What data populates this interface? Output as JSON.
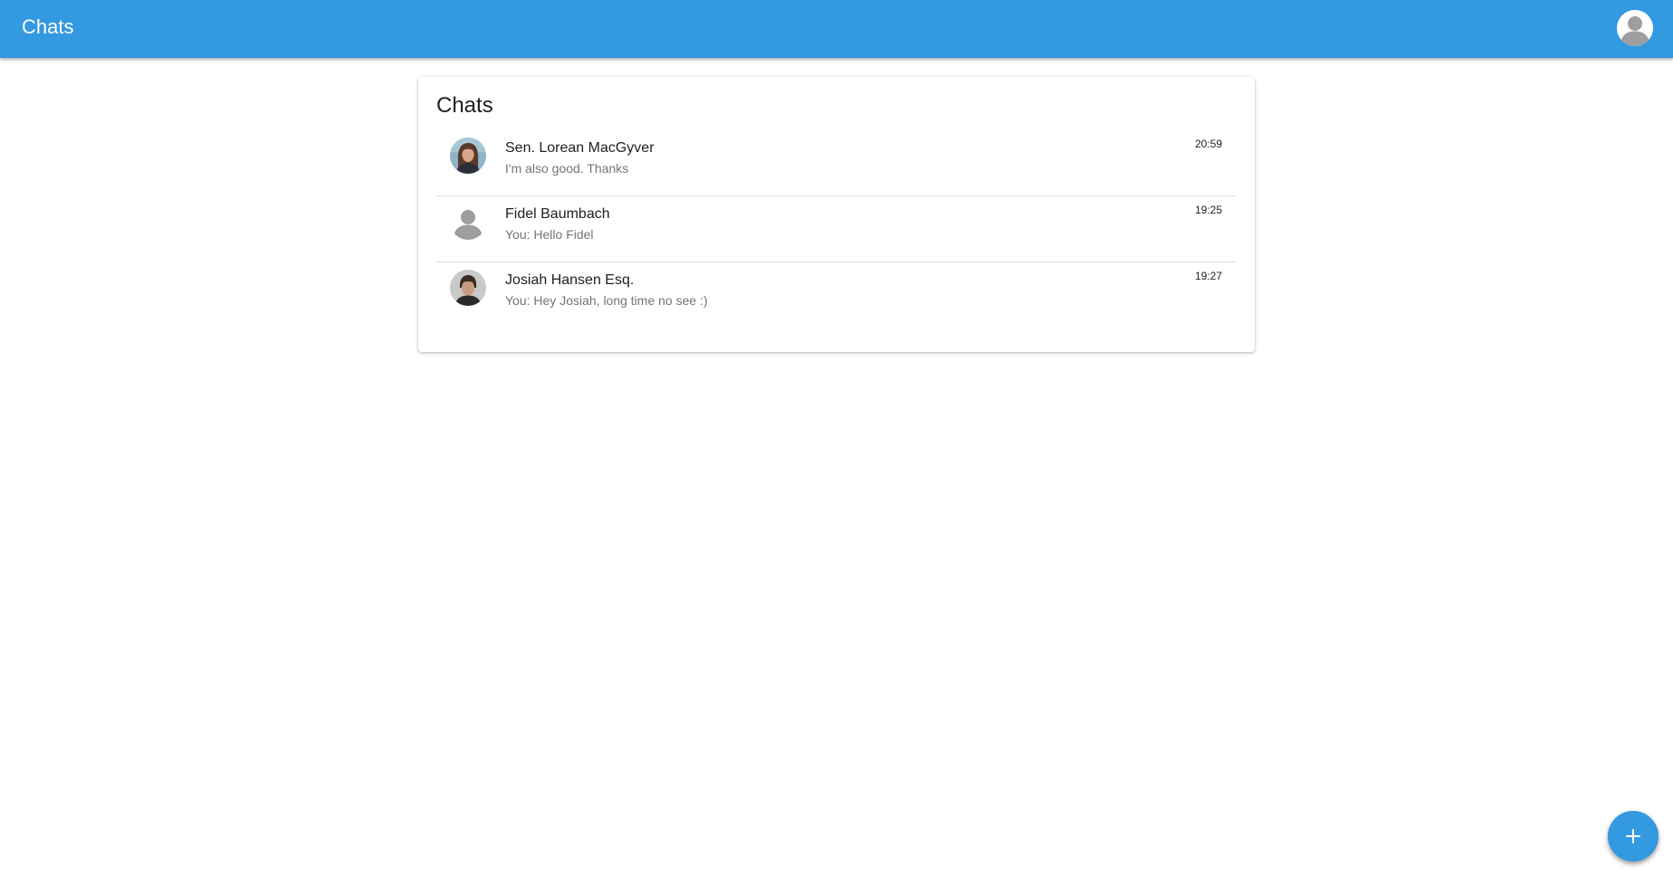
{
  "app": {
    "title": "Chats",
    "brand_color": "#3399e0"
  },
  "header": {
    "profile_icon": "user-avatar-icon"
  },
  "card": {
    "title": "Chats"
  },
  "chats": [
    {
      "name": "Sen. Lorean MacGyver",
      "preview": "I'm also good. Thanks",
      "time": "20:59",
      "avatar": "photo-woman-avatar"
    },
    {
      "name": "Fidel Baumbach",
      "preview": "You: Hello Fidel",
      "time": "19:25",
      "avatar": "default-user-avatar"
    },
    {
      "name": "Josiah Hansen Esq.",
      "preview": "You: Hey Josiah, long time no see :)",
      "time": "19:27",
      "avatar": "photo-man-avatar"
    }
  ],
  "fab": {
    "icon": "plus-icon"
  }
}
